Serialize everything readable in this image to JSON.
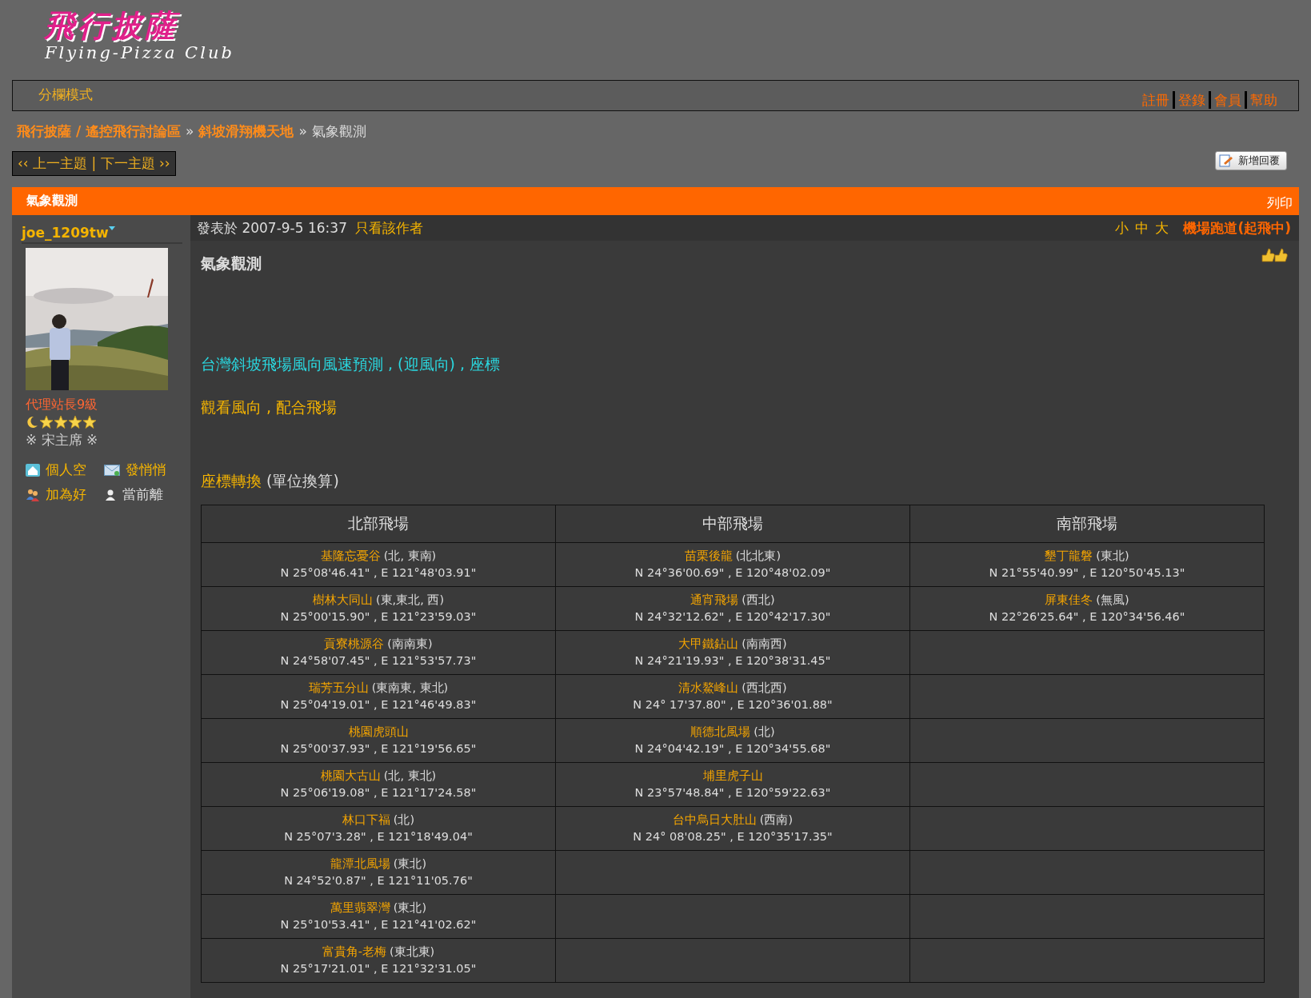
{
  "logo": {
    "title": "飛行披薩",
    "subtitle": "Flying-Pizza Club"
  },
  "topbar": {
    "mode_link": "分欄模式",
    "links": [
      "註冊",
      "登錄",
      "會員",
      "幫助"
    ]
  },
  "breadcrumb": [
    {
      "kind": "link",
      "text": "飛行披薩 / 遙控飛行討論區"
    },
    {
      "kind": "separator",
      "text": "»"
    },
    {
      "kind": "link",
      "text": "斜坡滑翔機天地"
    },
    {
      "kind": "separator",
      "text": "»"
    },
    {
      "kind": "current",
      "text": "氣象觀測"
    }
  ],
  "thread_nav": {
    "label": "‹‹ 上一主題 | 下一主題 ››"
  },
  "reply_button": {
    "label": "新增回覆"
  },
  "thread_bar": {
    "title": "氣象觀測",
    "print": "列印"
  },
  "author": {
    "name": "joe_1209tw",
    "rank": "代理站長9級",
    "stars": 4,
    "custom_title": "※ 宋主席 ※",
    "actions": [
      {
        "kind": "home",
        "label": "個人空"
      },
      {
        "kind": "mail",
        "label": "發悄悄"
      },
      {
        "kind": "friend",
        "label": "加為好"
      },
      {
        "kind": "offline",
        "label": "當前離"
      }
    ]
  },
  "post_meta": {
    "posted": "發表於 2007-9-5 16:37",
    "author_only": "只看該作者",
    "font_sizes": [
      "小",
      "中",
      "大"
    ],
    "runway": "機場跑道(起飛中)"
  },
  "post": {
    "title": "氣象觀測",
    "headline": "台灣斜坡飛場風向風速預測 , (迎風向) , 座標",
    "note": "觀看風向 , 配合飛場",
    "section_link": "座標轉換",
    "section_note": "(單位換算)"
  },
  "table": {
    "regions": [
      {
        "heading": "北部飛場",
        "sites": [
          {
            "name": "基隆忘憂谷",
            "wind": "(北, 東南)",
            "coords": "N 25°08'46.41\" , E 121°48'03.91\""
          },
          {
            "name": "樹林大同山",
            "wind": "(東,東北, 西)",
            "coords": "N 25°00'15.90\" , E 121°23'59.03\""
          },
          {
            "name": "貢寮桃源谷",
            "wind": "(南南東)",
            "coords": "N 24°58'07.45\" , E 121°53'57.73\""
          },
          {
            "name": "瑞芳五分山",
            "wind": "(東南東,  東北)",
            "coords": "N 25°04'19.01\" , E 121°46'49.83\""
          },
          {
            "name": "桃園虎頭山",
            "coords": "N 25°00'37.93\" , E 121°19'56.65\""
          },
          {
            "name": "桃園大古山",
            "wind": "(北, 東北)",
            "coords": "N 25°06'19.08\" , E 121°17'24.58\""
          },
          {
            "name": "林口下福",
            "wind": "(北)",
            "coords": "N 25°07'3.28\" , E 121°18'49.04\""
          },
          {
            "name": "龍潭北風場",
            "wind": "(東北)",
            "coords": "N 24°52'0.87\" , E 121°11'05.76\""
          },
          {
            "name": "萬里翡翠灣",
            "wind": "(東北)",
            "coords": "N 25°10'53.41\" , E 121°41'02.62\""
          },
          {
            "name": "富貴角-老梅",
            "wind": "(東北東)",
            "coords": "N 25°17'21.01\" , E 121°32'31.05\""
          }
        ]
      },
      {
        "heading": "中部飛場",
        "sites": [
          {
            "name": "苗栗後龍",
            "wind": "(北北東)",
            "coords": "N 24°36'00.69\" , E 120°48'02.09\""
          },
          {
            "name": "通宵飛場",
            "wind": "(西北)",
            "coords": "N 24°32'12.62\" , E 120°42'17.30\""
          },
          {
            "name": "大甲鐵鉆山",
            "wind": "(南南西)",
            "coords": "N 24°21'19.93\" , E 120°38'31.45\""
          },
          {
            "name": "清水鰲峰山",
            "wind": "(西北西)",
            "coords": "N 24° 17'37.80\" , E 120°36'01.88\""
          },
          {
            "name": "順德北風場",
            "wind": "(北)",
            "coords": "N 24°04'42.19\" , E 120°34'55.68\""
          },
          {
            "name": "埔里虎子山",
            "coords": "N 23°57'48.84\" , E 120°59'22.63\""
          },
          {
            "name": "台中烏日大肚山",
            "wind": "(西南)",
            "coords": "N 24° 08'08.25\" , E 120°35'17.35\""
          }
        ]
      },
      {
        "heading": "南部飛場",
        "sites": [
          {
            "name": "墾丁龍磐",
            "wind": "(東北)",
            "coords": "N 21°55'40.99\" , E 120°50'45.13\""
          },
          {
            "name": "屏東佳冬",
            "wind": "(無風)",
            "coords": "N 22°26'25.64\" , E 120°34'56.46\""
          }
        ]
      }
    ]
  }
}
